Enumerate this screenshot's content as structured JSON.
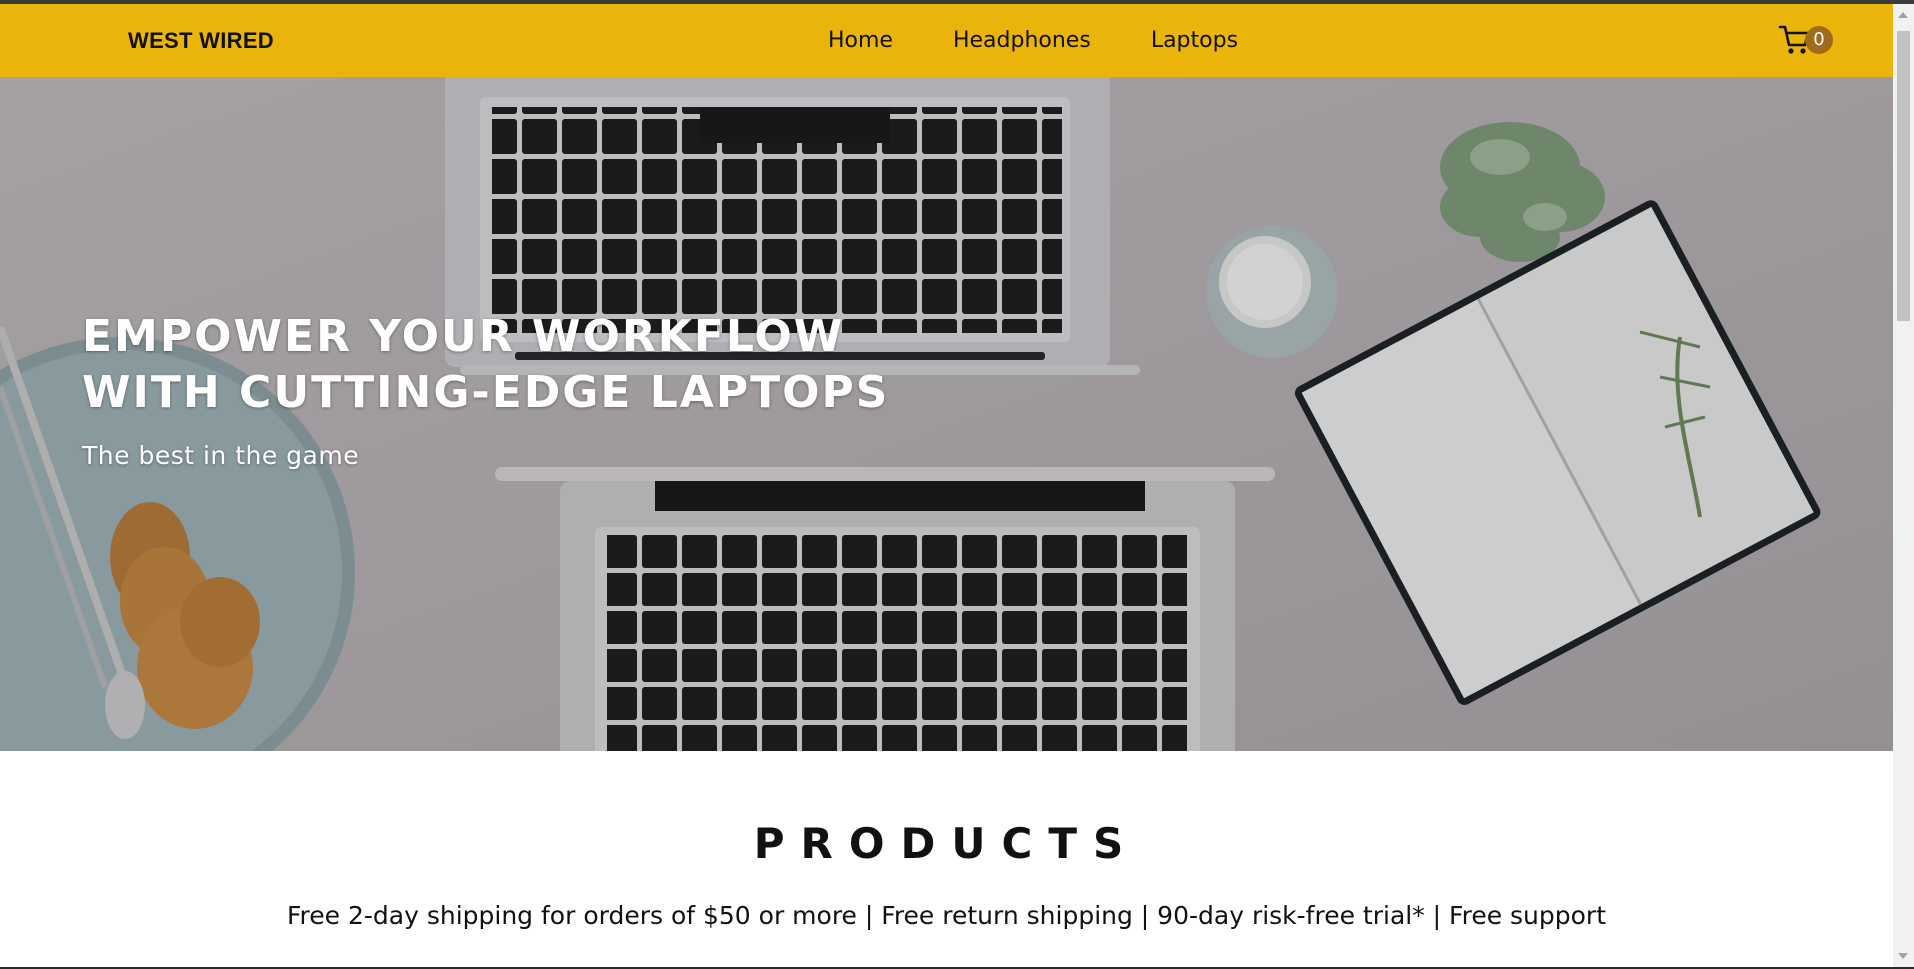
{
  "navbar": {
    "brand": "WEST WIRED",
    "links": [
      "Home",
      "Headphones",
      "Laptops"
    ],
    "cart_count": "0",
    "cart_icon": "shopping-cart-icon",
    "background": "#ebb40a"
  },
  "hero": {
    "title_line1": "EMPOWER YOUR WORKFLOW",
    "title_line2": "WITH CUTTING-EDGE LAPTOPS",
    "subtitle": "The best in the game"
  },
  "products": {
    "title": "PRODUCTS",
    "perks": "Free 2-day shipping for orders of $50 or more | Free return shipping | 90-day risk-free trial* | Free support"
  }
}
